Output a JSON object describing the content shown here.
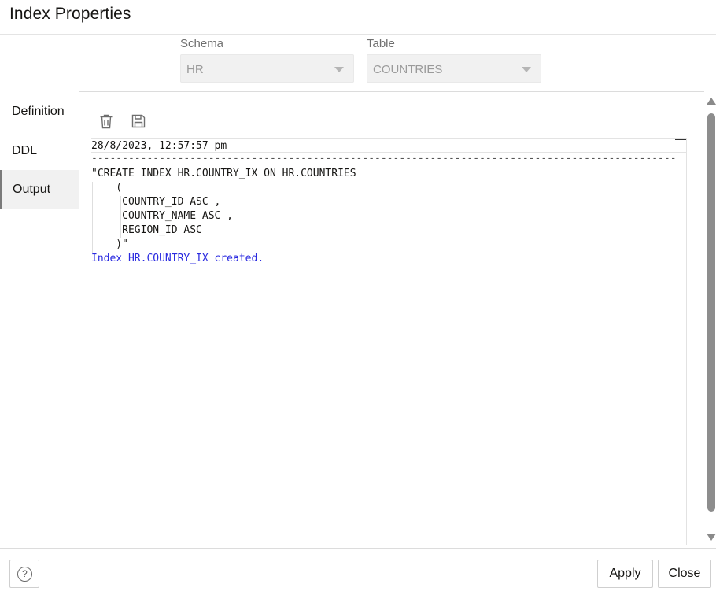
{
  "dialog": {
    "title": "Index Properties"
  },
  "fields": {
    "schema": {
      "label": "Schema",
      "value": "HR"
    },
    "table": {
      "label": "Table",
      "value": "COUNTRIES"
    }
  },
  "tabs": [
    {
      "label": "Definition",
      "active": false
    },
    {
      "label": "DDL",
      "active": false
    },
    {
      "label": "Output",
      "active": true
    }
  ],
  "toolbar": {
    "icons": [
      "trash-icon",
      "save-icon"
    ]
  },
  "output": {
    "timestamp": "28/8/2023, 12:57:57 pm",
    "separator": "------------------------------------------------------------------------------------------------",
    "code_lines": [
      "\"CREATE INDEX HR.COUNTRY_IX ON HR.COUNTRIES",
      "    (",
      "     COUNTRY_ID ASC ,",
      "     COUNTRY_NAME ASC ,",
      "     REGION_ID ASC",
      "    )\""
    ],
    "message": "Index HR.COUNTRY_IX created."
  },
  "footer": {
    "help_icon": "help-icon",
    "help_symbol": "?",
    "apply_label": "Apply",
    "close_label": "Close"
  },
  "colors": {
    "message": "#2a2ae0",
    "tab_active_bg": "#f1f1f1"
  }
}
